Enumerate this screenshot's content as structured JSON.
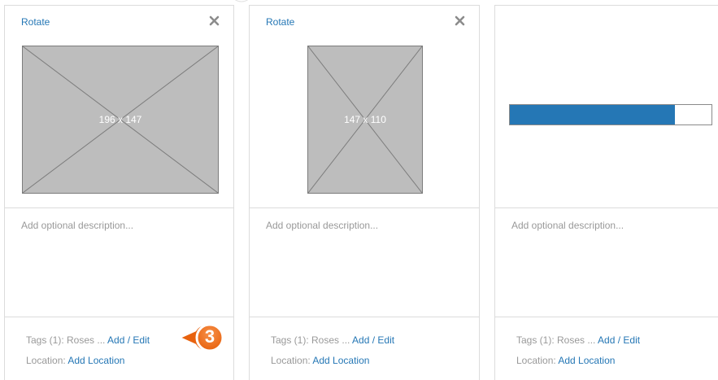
{
  "cards": [
    {
      "rotate_label": "Rotate",
      "thumb_label": "196 x 147",
      "description_placeholder": "Add optional description...",
      "tags_prefix": "Tags (1): Roses ... ",
      "tags_link": "Add / Edit",
      "location_prefix": "Location: ",
      "location_link": "Add Location"
    },
    {
      "rotate_label": "Rotate",
      "thumb_label": "147 x 110",
      "description_placeholder": "Add optional description...",
      "tags_prefix": "Tags (1): Roses ... ",
      "tags_link": "Add / Edit",
      "location_prefix": "Location: ",
      "location_link": "Add Location"
    },
    {
      "upload_progress": 0.82,
      "description_placeholder": "Add optional description...",
      "tags_prefix": "Tags (1): Roses ... ",
      "tags_link": "Add / Edit",
      "location_prefix": "Location: ",
      "location_link": "Add Location"
    }
  ],
  "step_badge": "3",
  "colors": {
    "link": "#2577b5",
    "progress_fill": "#2577b5",
    "badge": "#f0731f",
    "placeholder_image": "#bdbdbd"
  },
  "icons": [
    "close-icon",
    "image-placeholder-icon"
  ]
}
